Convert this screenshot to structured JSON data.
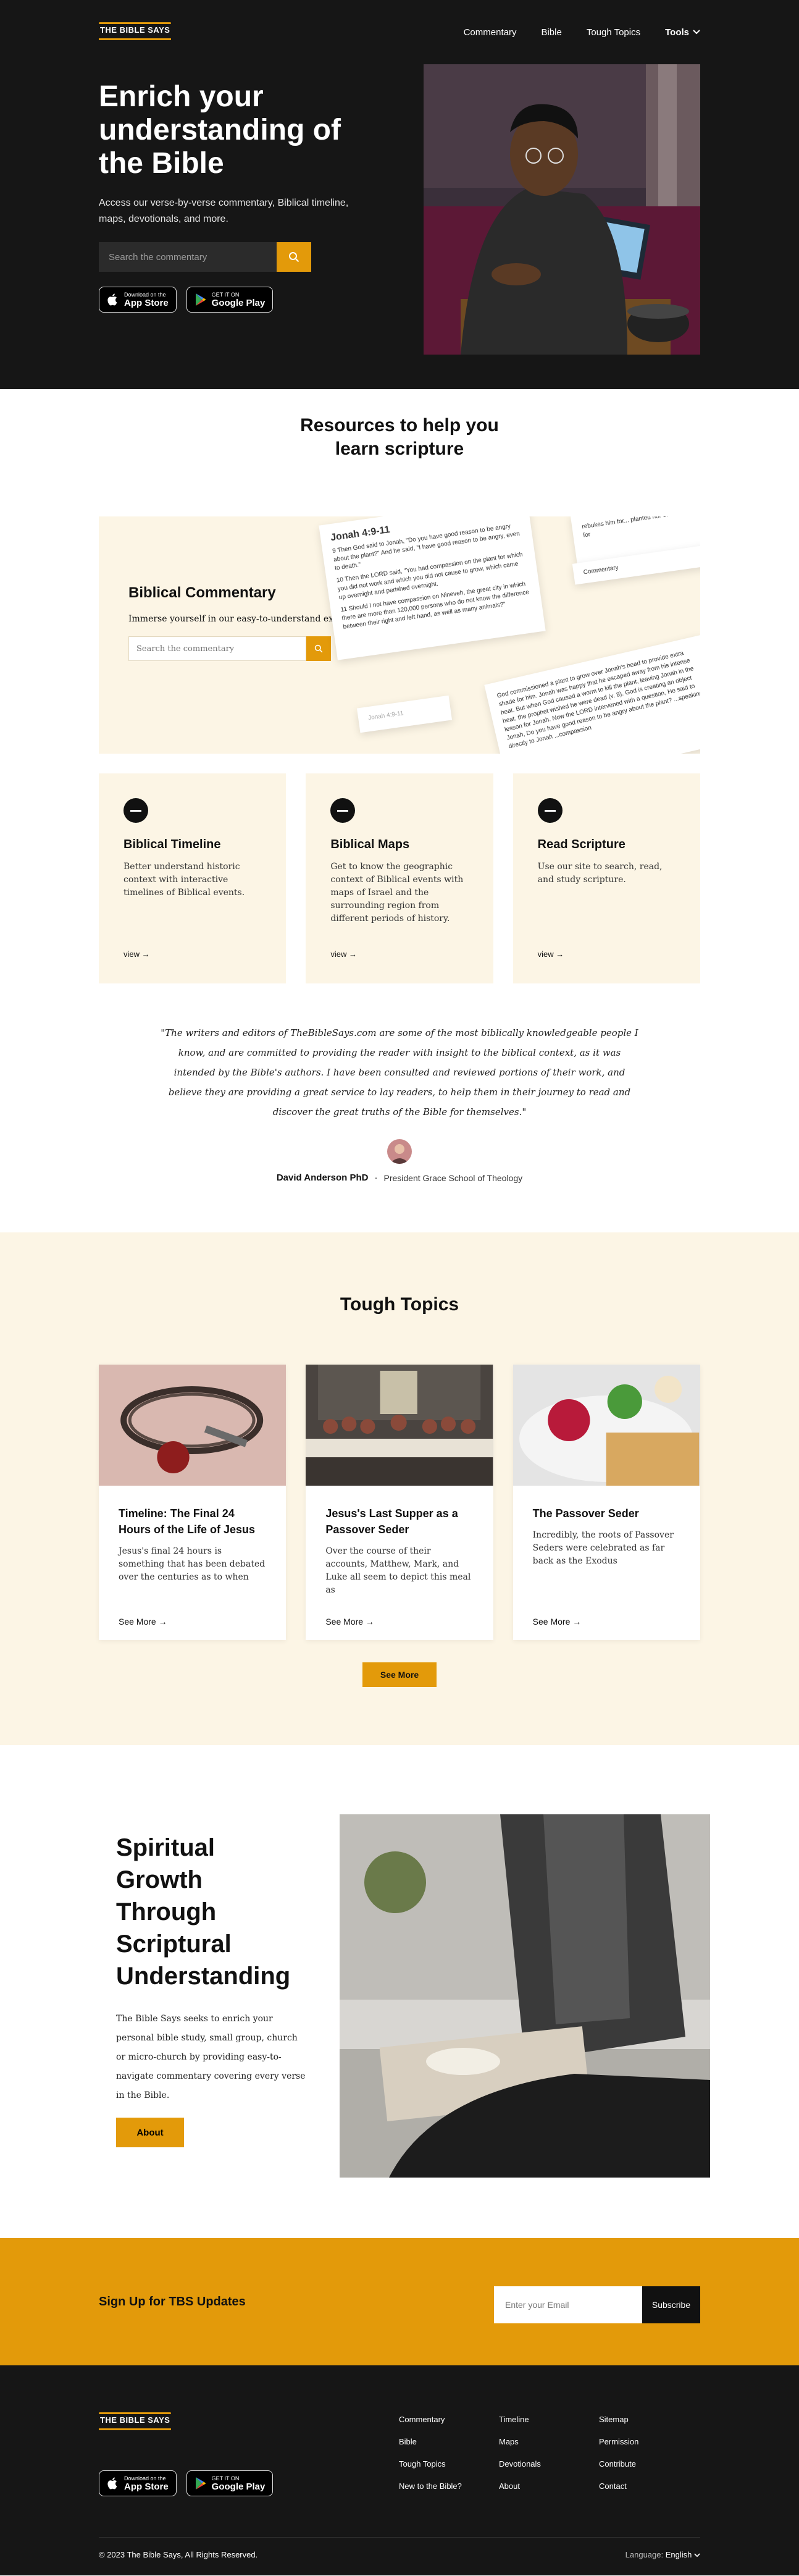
{
  "header": {
    "logo": "THE BIBLE SAYS",
    "nav": [
      "Commentary",
      "Bible",
      "Tough Topics",
      "Tools"
    ]
  },
  "hero": {
    "title": "Enrich your understanding of the Bible",
    "subtitle": "Access our verse-by-verse commentary, Biblical timeline, maps, devotionals, and more.",
    "search_placeholder": "Search the commentary",
    "app_store_top": "Download on the",
    "app_store": "App Store",
    "google_play_top": "GET IT ON",
    "google_play": "Google Play"
  },
  "resources": {
    "title": "Resources to help you learn scripture",
    "commentary": {
      "title": "Biblical Commentary",
      "text": "Immerse yourself in our easy-to-understand explan",
      "search_placeholder": "Search the commentary",
      "paper_heading": "Jonah 4:9-11",
      "verse9": "9 Then God said to Jonah, \"Do you have good reason to be angry about the plant?\" And he said, \"I have good reason to be angry, even to death.\"",
      "verse10": "10 Then the LORD said, \"You had compassion on the plant for which you did not work and which you did not cause to grow, which came up overnight and perished overnight.",
      "verse11": "11 Should I not have compassion on Nineveh, the great city in which there are more than 120,000 persons who do not know the difference between their right and left hand, as well as many animals?\"",
      "paper_top": "rebukes him for... planted nor cultivated than for",
      "paper_label": "Commentary",
      "paper_ref": "Jonah 4:9-11",
      "paper_text": "God commissioned a plant to grow over Jonah's head to provide extra shade for him. Jonah was happy that he escaped away from his intense heat. But when God caused a worm to kill the plant, leaving Jonah in the heat, the prophet wished he were dead (v. 8). God is creating an object lesson for Jonah. Now the LORD intervened with a question, He said to Jonah, Do you have good reason to be angry about the plant? ...speaking directly to Jonah ...compassion"
    },
    "features": [
      {
        "title": "Biblical Timeline",
        "text": "Better understand historic context with interactive timelines of Biblical events.",
        "link": "view"
      },
      {
        "title": "Biblical Maps",
        "text": "Get to know the geographic context of Biblical events with maps of Israel and the surrounding region from different periods of history.",
        "link": "view"
      },
      {
        "title": "Read Scripture",
        "text": "Use our site to search, read, and study scripture.",
        "link": "view"
      }
    ]
  },
  "testimonial": {
    "quote": "\"The writers and editors of TheBibleSays.com are some of the most biblically knowledgeable people I know, and are committed to providing the reader with insight to the biblical context, as it was intended by the Bible's authors. I have been consulted and reviewed portions of their work, and believe they are providing a great service to lay readers, to help them in their journey to read and discover the great truths of the Bible for themselves.\"",
    "name": "David Anderson PhD",
    "separator": "·",
    "role": "President Grace School of Theology"
  },
  "tough_topics": {
    "title": "Tough Topics",
    "items": [
      {
        "title": "Timeline: The Final 24 Hours of the Life of Jesus",
        "text": "Jesus's final 24 hours is something that has been debated over the centuries as to when",
        "link": "See More"
      },
      {
        "title": "Jesus's Last Supper as a Passover Seder",
        "text": "Over the course of their accounts, Matthew, Mark, and Luke all seem to depict this meal as",
        "link": "See More"
      },
      {
        "title": "The Passover Seder",
        "text": "Incredibly, the roots of Passover Seders were celebrated as far back as the Exodus",
        "link": "See More"
      }
    ],
    "button": "See More"
  },
  "spiritual": {
    "title": "Spiritual Growth Through Scriptural Understanding",
    "text": "The Bible Says seeks to enrich your personal bible study, small group, church or micro-church by providing easy-to-navigate commentary covering every verse in the Bible.",
    "button": "About"
  },
  "signup": {
    "title": "Sign Up for TBS Updates",
    "placeholder": "Enter your Email",
    "button": "Subscribe"
  },
  "footer": {
    "logo": "THE BIBLE SAYS",
    "col1": [
      "Commentary",
      "Bible",
      "Tough Topics",
      "New to the Bible?"
    ],
    "col2": [
      "Timeline",
      "Maps",
      "Devotionals",
      "About"
    ],
    "col3": [
      "Sitemap",
      "Permission",
      "Contribute",
      "Contact"
    ],
    "copyright": "© 2023 The Bible Says, All Rights Reserved.",
    "language_label": "Language:",
    "language": "English"
  },
  "colors": {
    "accent": "#e39a0a",
    "dark": "#161616",
    "cream": "#fcf5e5"
  },
  "icons": [
    "search-icon",
    "apple-icon",
    "google-play-icon",
    "chevron-down-icon",
    "arrow-right-icon"
  ]
}
